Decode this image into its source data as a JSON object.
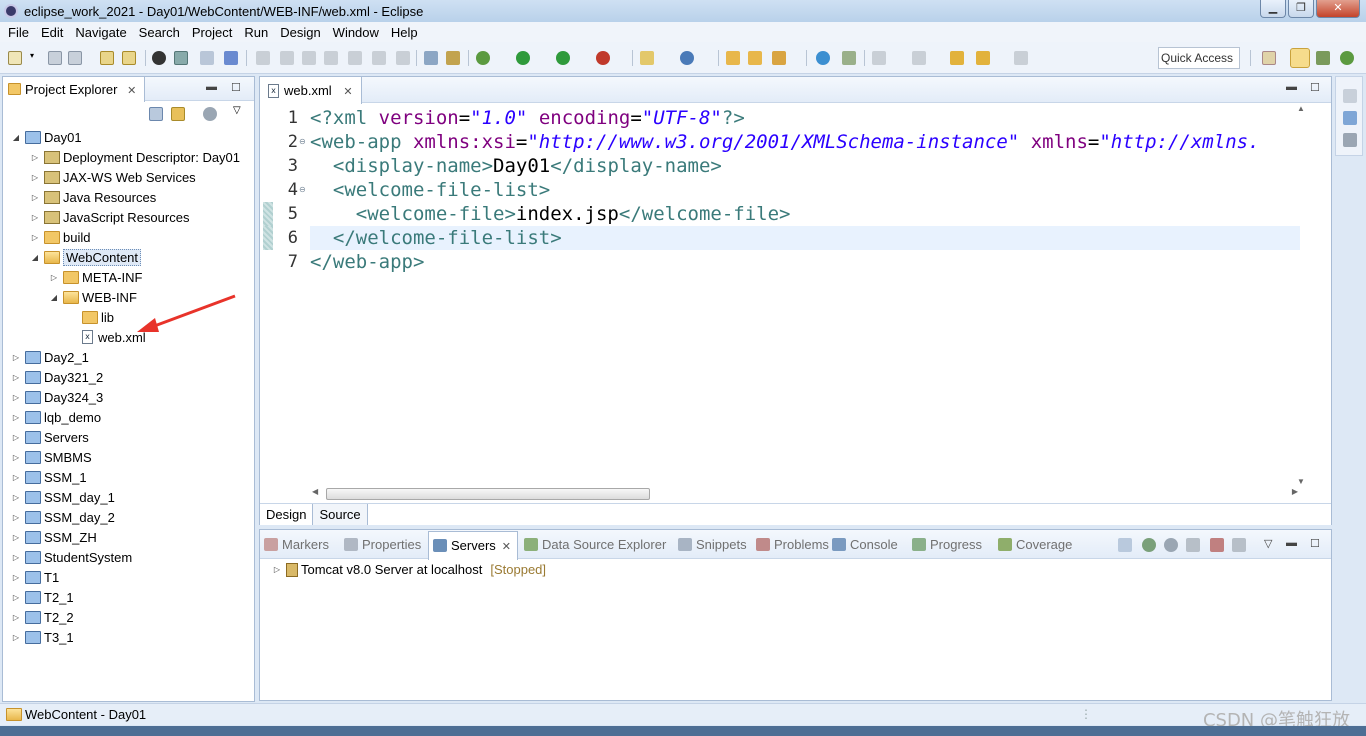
{
  "window": {
    "title": "eclipse_work_2021 - Day01/WebContent/WEB-INF/web.xml - Eclipse"
  },
  "menu": [
    "File",
    "Edit",
    "Navigate",
    "Search",
    "Project",
    "Run",
    "Design",
    "Window",
    "Help"
  ],
  "toolbar": {
    "quick_access": "Quick Access"
  },
  "project_explorer": {
    "tab_label": "Project Explorer",
    "tree": [
      {
        "label": "Day01",
        "twisty": "◢",
        "icon": "project-icon",
        "level": 0
      },
      {
        "label": "Deployment Descriptor: Day01",
        "twisty": "▷",
        "icon": "deployment-descriptor-icon",
        "level": 1
      },
      {
        "label": "JAX-WS Web Services",
        "twisty": "▷",
        "icon": "web-services-icon",
        "level": 1
      },
      {
        "label": "Java Resources",
        "twisty": "▷",
        "icon": "java-resources-icon",
        "level": 1
      },
      {
        "label": "JavaScript Resources",
        "twisty": "▷",
        "icon": "javascript-resources-icon",
        "level": 1
      },
      {
        "label": "build",
        "twisty": "▷",
        "icon": "folder-icon",
        "level": 1
      },
      {
        "label": "WebContent",
        "twisty": "◢",
        "icon": "folder-open-icon",
        "level": 1,
        "selected": true
      },
      {
        "label": "META-INF",
        "twisty": "▷",
        "icon": "folder-icon",
        "level": 2
      },
      {
        "label": "WEB-INF",
        "twisty": "◢",
        "icon": "folder-open-icon",
        "level": 2
      },
      {
        "label": "lib",
        "twisty": "",
        "icon": "folder-icon",
        "level": 3
      },
      {
        "label": "web.xml",
        "twisty": "",
        "icon": "xml-file-icon",
        "level": 3
      },
      {
        "label": "Day2_1",
        "twisty": "▷",
        "icon": "project-icon",
        "level": 0
      },
      {
        "label": "Day321_2",
        "twisty": "▷",
        "icon": "project-icon",
        "level": 0
      },
      {
        "label": "Day324_3",
        "twisty": "▷",
        "icon": "project-icon",
        "level": 0
      },
      {
        "label": "lqb_demo",
        "twisty": "▷",
        "icon": "project-icon",
        "level": 0
      },
      {
        "label": "Servers",
        "twisty": "▷",
        "icon": "project-icon",
        "level": 0
      },
      {
        "label": "SMBMS",
        "twisty": "▷",
        "icon": "project-icon",
        "level": 0
      },
      {
        "label": "SSM_1",
        "twisty": "▷",
        "icon": "project-icon",
        "level": 0
      },
      {
        "label": "SSM_day_1",
        "twisty": "▷",
        "icon": "project-icon",
        "level": 0
      },
      {
        "label": "SSM_day_2",
        "twisty": "▷",
        "icon": "project-icon",
        "level": 0
      },
      {
        "label": "SSM_ZH",
        "twisty": "▷",
        "icon": "project-icon",
        "level": 0
      },
      {
        "label": "StudentSystem",
        "twisty": "▷",
        "icon": "project-icon",
        "level": 0
      },
      {
        "label": "T1",
        "twisty": "▷",
        "icon": "project-icon",
        "level": 0
      },
      {
        "label": "T2_1",
        "twisty": "▷",
        "icon": "project-icon",
        "level": 0
      },
      {
        "label": "T2_2",
        "twisty": "▷",
        "icon": "project-icon",
        "level": 0
      },
      {
        "label": "T3_1",
        "twisty": "▷",
        "icon": "project-icon",
        "level": 0
      }
    ]
  },
  "editor": {
    "tab_label": "web.xml",
    "line_numbers": [
      "1",
      "2",
      "3",
      "4",
      "5",
      "6",
      "7"
    ],
    "lines": [
      [
        {
          "t": "tag",
          "v": "<?xml "
        },
        {
          "t": "attr",
          "v": "version"
        },
        {
          "t": "text",
          "v": "="
        },
        {
          "t": "val",
          "v": "\"1.0\""
        },
        {
          "t": "text",
          "v": " "
        },
        {
          "t": "attr",
          "v": "encoding"
        },
        {
          "t": "text",
          "v": "="
        },
        {
          "t": "val",
          "v": "\"UTF-8\""
        },
        {
          "t": "tag",
          "v": "?>"
        }
      ],
      [
        {
          "t": "tag",
          "v": "<web-app "
        },
        {
          "t": "attr",
          "v": "xmlns:xsi"
        },
        {
          "t": "text",
          "v": "="
        },
        {
          "t": "val",
          "v": "\"http://www.w3.org/2001/XMLSchema-instance\""
        },
        {
          "t": "text",
          "v": " "
        },
        {
          "t": "attr",
          "v": "xmlns"
        },
        {
          "t": "text",
          "v": "="
        },
        {
          "t": "val",
          "v": "\"http://xmlns."
        }
      ],
      [
        {
          "t": "text",
          "v": "  "
        },
        {
          "t": "tag",
          "v": "<display-name>"
        },
        {
          "t": "text",
          "v": "Day01"
        },
        {
          "t": "tag",
          "v": "</display-name>"
        }
      ],
      [
        {
          "t": "text",
          "v": "  "
        },
        {
          "t": "tag",
          "v": "<welcome-file-list>"
        }
      ],
      [
        {
          "t": "text",
          "v": "    "
        },
        {
          "t": "tag",
          "v": "<welcome-file>"
        },
        {
          "t": "text",
          "v": "index.jsp"
        },
        {
          "t": "tag",
          "v": "</welcome-file>"
        }
      ],
      [
        {
          "t": "text",
          "v": "  "
        },
        {
          "t": "tag",
          "v": "</welcome-file-list>"
        }
      ],
      [
        {
          "t": "tag",
          "v": "</web-app>"
        }
      ]
    ],
    "bottom_tabs": [
      "Design",
      "Source"
    ],
    "active_bottom_tab": "Source",
    "current_line": 6
  },
  "bottom_panel": {
    "tabs": [
      {
        "label": "Markers",
        "icon": "markers-icon"
      },
      {
        "label": "Properties",
        "icon": "properties-icon"
      },
      {
        "label": "Servers",
        "icon": "servers-icon",
        "active": true
      },
      {
        "label": "Data Source Explorer",
        "icon": "data-source-icon"
      },
      {
        "label": "Snippets",
        "icon": "snippets-icon"
      },
      {
        "label": "Problems",
        "icon": "problems-icon"
      },
      {
        "label": "Console",
        "icon": "console-icon"
      },
      {
        "label": "Progress",
        "icon": "progress-icon"
      },
      {
        "label": "Coverage",
        "icon": "coverage-icon"
      }
    ],
    "servers": [
      {
        "name": "Tomcat v8.0 Server at localhost",
        "status": "[Stopped]"
      }
    ]
  },
  "status_bar": {
    "text": "WebContent - Day01"
  },
  "watermark": "CSDN @笔触狂放",
  "colors": {
    "tag": "#3a7a7a",
    "attr": "#7f007f",
    "value": "#2a00ff",
    "annotation_arrow": "#e8332a"
  }
}
